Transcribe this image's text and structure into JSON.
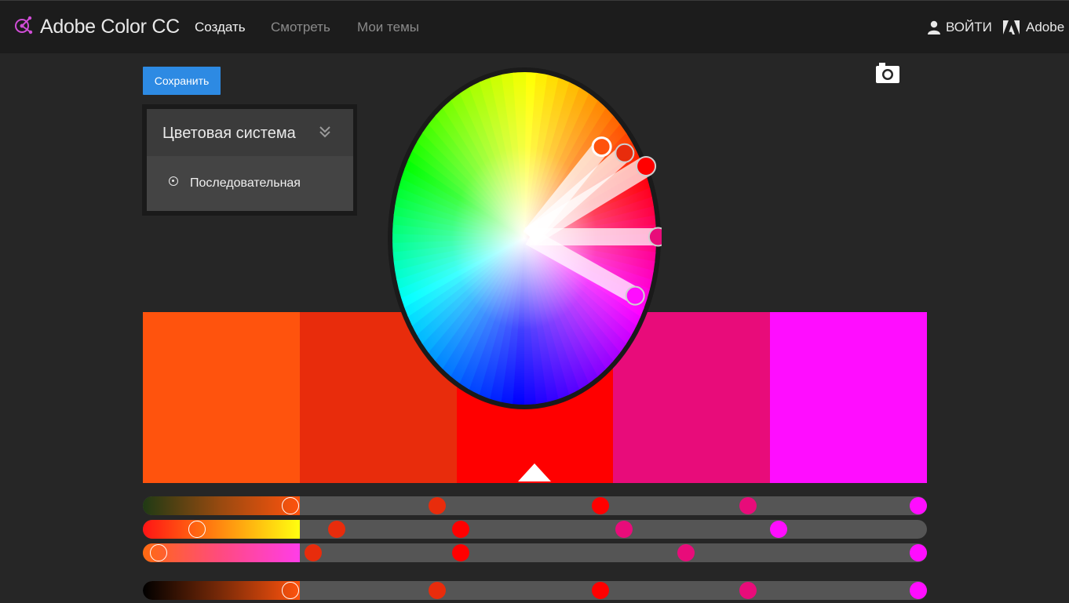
{
  "header": {
    "brand": "Adobe Color CC",
    "nav": [
      {
        "label": "Создать",
        "active": true
      },
      {
        "label": "Смотреть",
        "active": false
      },
      {
        "label": "Мои темы",
        "active": false
      }
    ],
    "login_label": "ВОЙТИ",
    "adobe_label": "Adobe"
  },
  "toolbar": {
    "save_label": "Сохранить",
    "camera_icon": "camera-icon"
  },
  "rules_panel": {
    "title": "Цветовая система",
    "selected_rule": "Последовательная"
  },
  "theme": {
    "colors": [
      "#FF530D",
      "#E82C0C",
      "#FF0000",
      "#E80C7A",
      "#FF0DFF"
    ],
    "selected_index": 2
  },
  "sliders": {
    "values": [
      [
        0.19,
        0.38,
        0.59,
        0.78,
        1.0
      ],
      [
        0.07,
        0.25,
        0.41,
        0.62,
        0.82
      ],
      [
        0.02,
        0.22,
        0.41,
        0.7,
        1.0
      ],
      [
        0.19,
        0.38,
        0.59,
        0.78,
        1.0
      ]
    ]
  }
}
